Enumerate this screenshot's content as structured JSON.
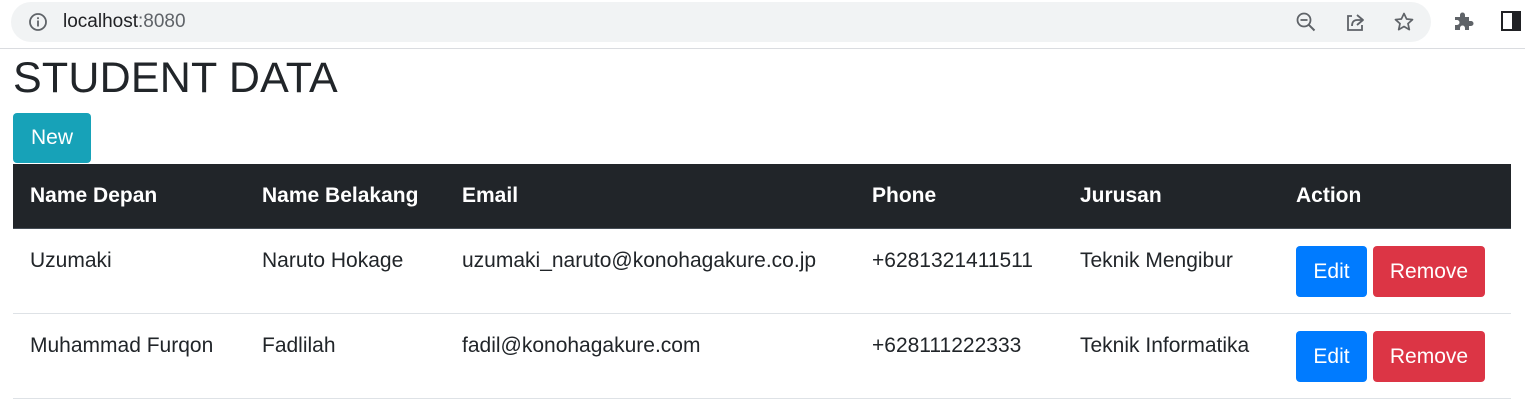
{
  "browser": {
    "url_host": "localhost",
    "url_port": ":8080",
    "icons": [
      "info-icon",
      "zoom-out-icon",
      "share-icon",
      "bookmark-star-icon",
      "extensions-puzzle-icon",
      "side-panel-icon"
    ]
  },
  "page": {
    "title": "STUDENT DATA",
    "new_button_label": "New"
  },
  "table": {
    "headers": [
      "Name Depan",
      "Name Belakang",
      "Email",
      "Phone",
      "Jurusan",
      "Action"
    ],
    "rows": [
      {
        "first_name": "Uzumaki",
        "last_name": "Naruto Hokage",
        "email": "uzumaki_naruto@konohagakure.co.jp",
        "phone": "+6281321411511",
        "major": "Teknik Mengibur",
        "edit_label": "Edit",
        "remove_label": "Remove"
      },
      {
        "first_name": "Muhammad Furqon",
        "last_name": "Fadlilah",
        "email": "fadil@konohagakure.com",
        "phone": "+628111222333",
        "major": "Teknik Informatika",
        "edit_label": "Edit",
        "remove_label": "Remove"
      }
    ]
  },
  "colors": {
    "new_button": "#17a2b8",
    "edit_button": "#007bff",
    "remove_button": "#dc3545",
    "table_header": "#212529"
  }
}
